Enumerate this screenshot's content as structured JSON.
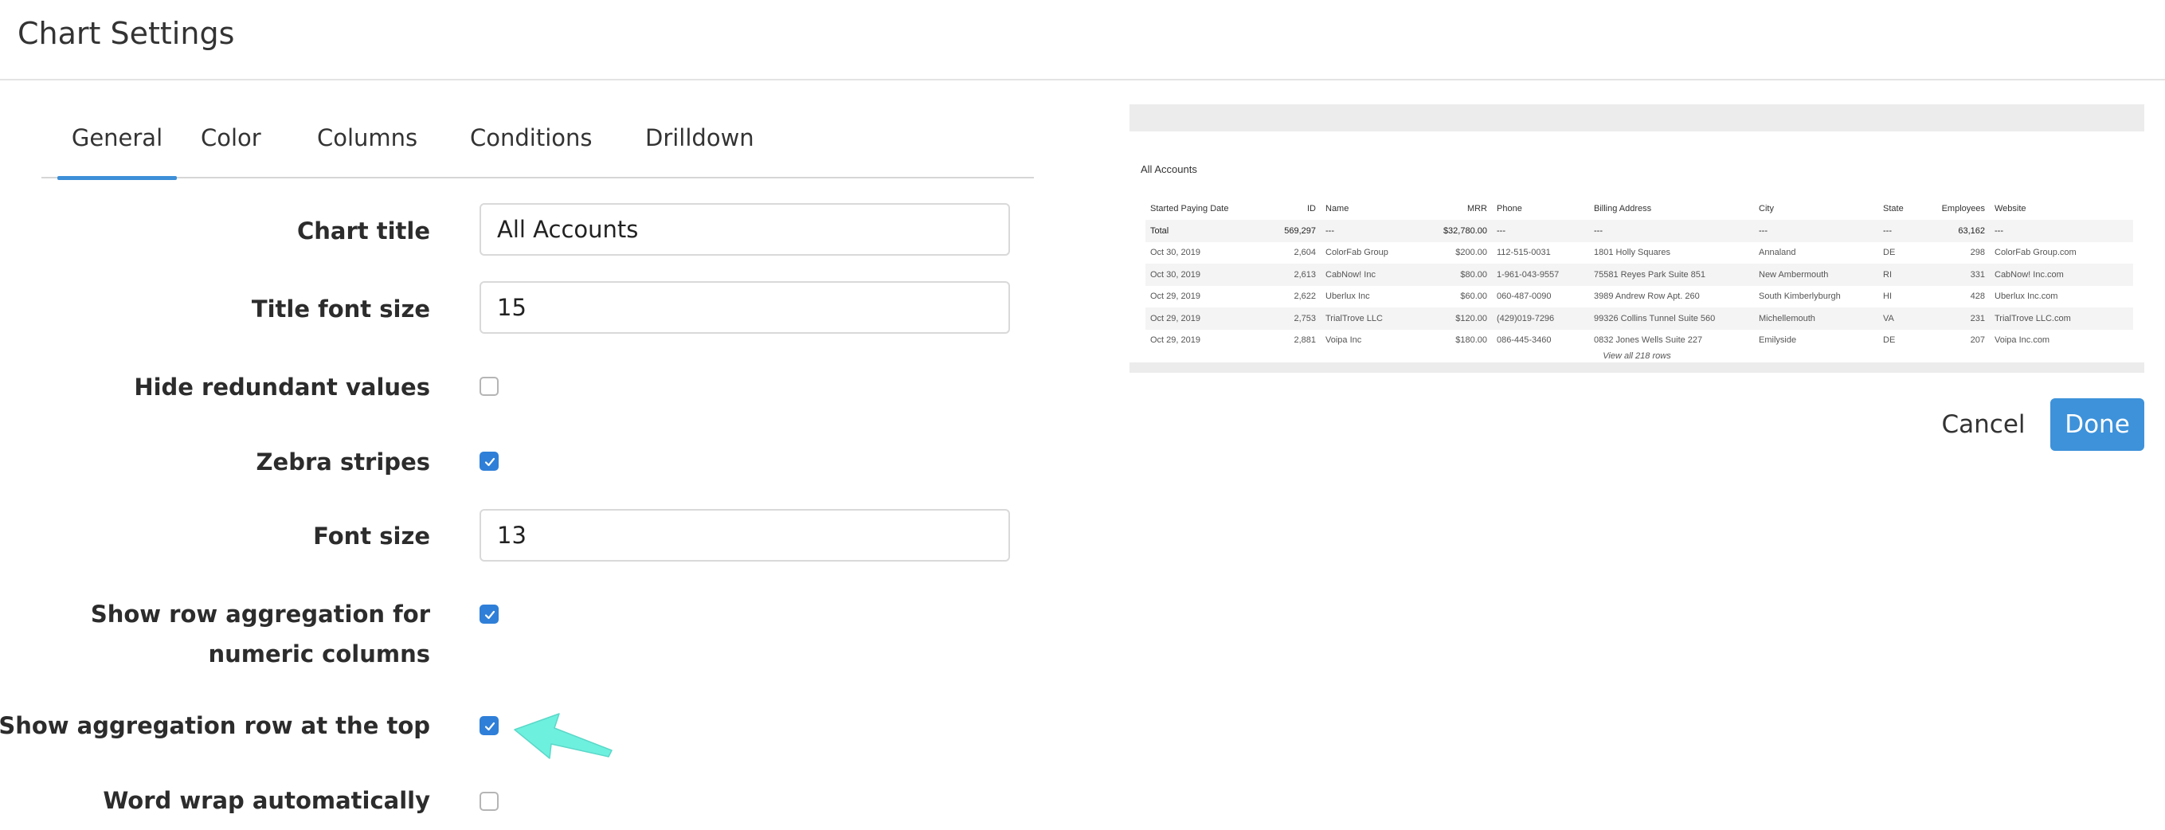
{
  "header": {
    "title": "Chart Settings"
  },
  "tabs": [
    {
      "label": "General",
      "active": true
    },
    {
      "label": "Color",
      "active": false
    },
    {
      "label": "Columns",
      "active": false
    },
    {
      "label": "Conditions",
      "active": false
    },
    {
      "label": "Drilldown",
      "active": false
    }
  ],
  "form": {
    "chart_title": {
      "label": "Chart title",
      "value": "All Accounts"
    },
    "title_font_size": {
      "label": "Title font size",
      "value": "15"
    },
    "hide_redundant": {
      "label": "Hide redundant values",
      "checked": false
    },
    "zebra": {
      "label": "Zebra stripes",
      "checked": true
    },
    "font_size": {
      "label": "Font size",
      "value": "13"
    },
    "row_aggregation": {
      "label_line1": "Show row aggregation for",
      "label_line2": "numeric columns",
      "checked": true
    },
    "agg_row_top": {
      "label": "Show aggregation row at the top",
      "checked": true
    },
    "word_wrap": {
      "label": "Word wrap automatically",
      "checked": false
    }
  },
  "preview": {
    "title": "All Accounts",
    "columns": [
      "Started Paying Date",
      "ID",
      "Name",
      "MRR",
      "Phone",
      "Billing Address",
      "City",
      "State",
      "Employees",
      "Website"
    ],
    "total": [
      "Total",
      "569,297",
      "---",
      "$32,780.00",
      "---",
      "---",
      "---",
      "---",
      "63,162",
      "---"
    ],
    "rows": [
      [
        "Oct 30, 2019",
        "2,604",
        "ColorFab Group",
        "$200.00",
        "112-515-0031",
        "1801 Holly Squares",
        "Annaland",
        "DE",
        "298",
        "ColorFab Group.com"
      ],
      [
        "Oct 30, 2019",
        "2,613",
        "CabNow! Inc",
        "$80.00",
        "1-961-043-9557",
        "75581 Reyes Park Suite 851",
        "New Ambermouth",
        "RI",
        "331",
        "CabNow! Inc.com"
      ],
      [
        "Oct 29, 2019",
        "2,622",
        "Uberlux Inc",
        "$60.00",
        "060-487-0090",
        "3989 Andrew Row Apt. 260",
        "South Kimberlyburgh",
        "HI",
        "428",
        "Uberlux Inc.com"
      ],
      [
        "Oct 29, 2019",
        "2,753",
        "TrialTrove LLC",
        "$120.00",
        "(429)019-7296",
        "99326 Collins Tunnel Suite 560",
        "Michellemouth",
        "VA",
        "231",
        "TrialTrove LLC.com"
      ],
      [
        "Oct 29, 2019",
        "2,881",
        "Voipa Inc",
        "$180.00",
        "086-445-3460",
        "0832 Jones Wells Suite 227",
        "Emilyside",
        "DE",
        "207",
        "Voipa Inc.com"
      ]
    ],
    "footer": "View all 218 rows"
  },
  "actions": {
    "cancel": "Cancel",
    "done": "Done"
  },
  "colors": {
    "accent": "#3d92da",
    "checkbox": "#2f7fd8",
    "arrow": "#6ef0df"
  }
}
